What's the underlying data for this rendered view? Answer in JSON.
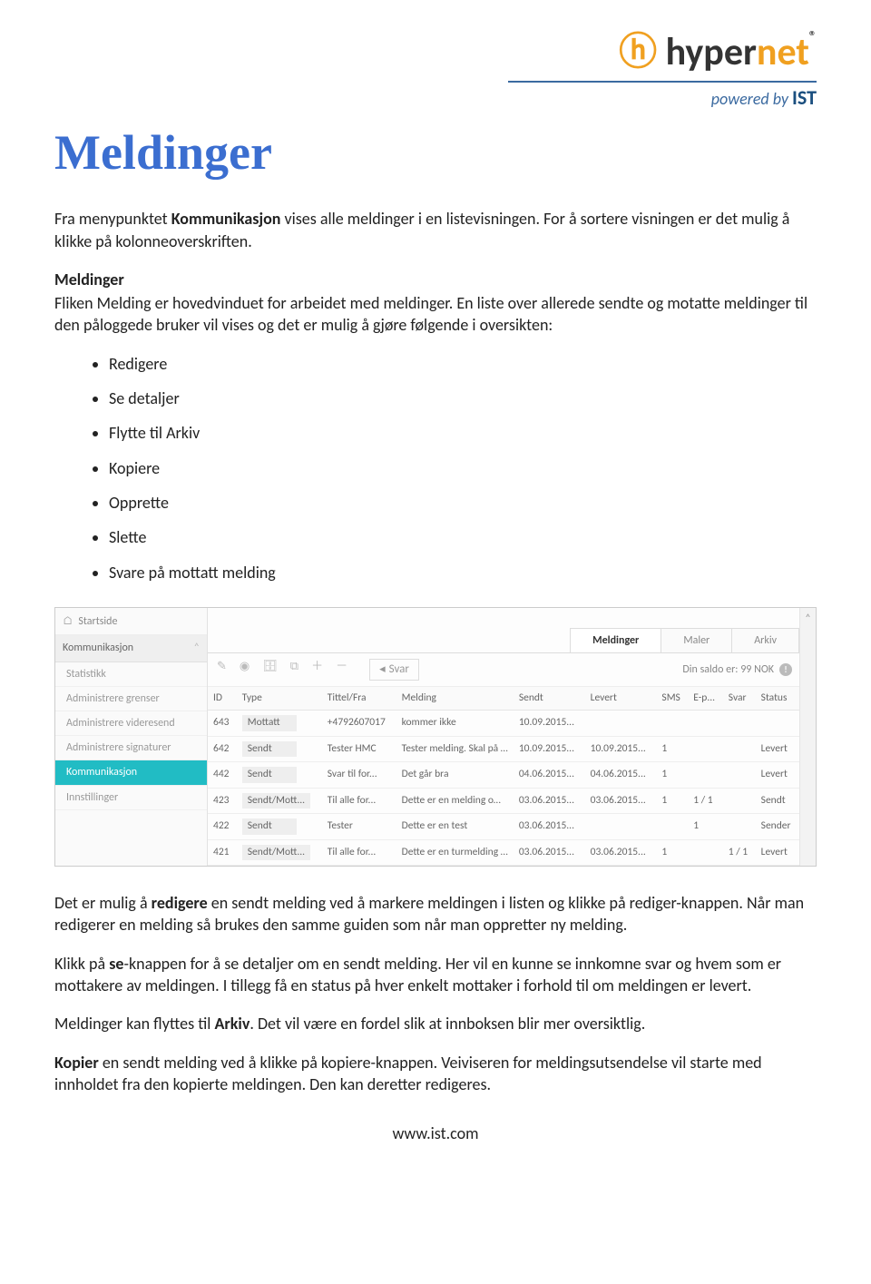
{
  "logo": {
    "brand_part1": "hyper",
    "brand_part2": "net",
    "tagline_prefix": "powered by ",
    "tagline_brand": "IST"
  },
  "title": "Meldinger",
  "intro": {
    "pre": "Fra menypunktet ",
    "bold": "Kommunikasjon",
    "post": " vises alle meldinger i en listevisningen. For å sortere visningen er det mulig å klikke på kolonneoverskriften."
  },
  "section_heading": "Meldinger",
  "section_body": "Fliken Melding er hovedvinduet for arbeidet med meldinger. En liste over allerede sendte og motatte meldinger til den påloggede bruker vil vises og det er mulig å gjøre følgende i oversikten:",
  "actions": [
    "Redigere",
    "Se detaljer",
    "Flytte til Arkiv",
    "Kopiere",
    "Opprette",
    "Slette",
    "Svare på mottatt melding"
  ],
  "app": {
    "sidebar": {
      "home": "Startside",
      "section": "Kommunikasjon",
      "items": [
        "Statistikk",
        "Administrere grenser",
        "Administrere videresend",
        "Administrere signaturer",
        "Kommunikasjon",
        "Innstillinger"
      ],
      "active_index": 4
    },
    "tabs": [
      "Meldinger",
      "Maler",
      "Arkiv"
    ],
    "active_tab_index": 0,
    "toolbar": {
      "svar": "Svar",
      "saldo": "Din saldo er: 99 NOK"
    },
    "columns": [
      "ID",
      "Type",
      "Tittel/Fra",
      "Melding",
      "Sendt",
      "Levert",
      "SMS",
      "E-p...",
      "Svar",
      "Status"
    ],
    "rows": [
      {
        "id": "643",
        "type": "Mottatt",
        "tittel": "+4792607017",
        "melding": "kommer ikke",
        "sendt": "10.09.2015...",
        "levert": "",
        "sms": "",
        "ep": "",
        "svar": "",
        "status": ""
      },
      {
        "id": "642",
        "type": "Sendt",
        "tittel": "Tester HMC",
        "melding": "Tester melding. Skal på tur",
        "sendt": "10.09.2015...",
        "levert": "10.09.2015...",
        "sms": "1",
        "ep": "",
        "svar": "",
        "status": "Levert"
      },
      {
        "id": "442",
        "type": "Sendt",
        "tittel": "Svar til for...",
        "melding": "Det går bra",
        "sendt": "04.06.2015...",
        "levert": "04.06.2015...",
        "sms": "1",
        "ep": "",
        "svar": "",
        "status": "Levert"
      },
      {
        "id": "423",
        "type": "Sendt/Mott...",
        "tittel": "Til alle for...",
        "melding": "Dette er en melding om tu...",
        "sendt": "03.06.2015...",
        "levert": "03.06.2015...",
        "sms": "1",
        "ep": "1 / 1",
        "svar": "",
        "status": "Sendt"
      },
      {
        "id": "422",
        "type": "Sendt",
        "tittel": "Tester",
        "melding": "Dette er en test",
        "sendt": "03.06.2015...",
        "levert": "",
        "sms": "",
        "ep": "1",
        "svar": "",
        "status": "Sender"
      },
      {
        "id": "421",
        "type": "Sendt/Mott...",
        "tittel": "Til alle for...",
        "melding": "Dette er en turmelding en...",
        "sendt": "03.06.2015...",
        "levert": "03.06.2015...",
        "sms": "1",
        "ep": "",
        "svar": "1 / 1",
        "status": "Levert"
      }
    ]
  },
  "para_redigere": {
    "p1": "Det er mulig å ",
    "b1": "redigere",
    "p2": " en sendt melding ved å markere meldingen i listen og klikke på rediger-knappen. Når man redigerer en melding så brukes den samme guiden som når man oppretter ny melding."
  },
  "para_se": {
    "p1": "Klikk på ",
    "b1": "se",
    "p2": "-knappen for å se detaljer om en sendt melding. Her vil en kunne se innkomne svar og hvem som er mottakere av meldingen. I tillegg få en status på hver enkelt mottaker i forhold til om meldingen er levert."
  },
  "para_arkiv": {
    "p1": "Meldinger kan flyttes til ",
    "b1": "Arkiv",
    "p2": ". Det vil være en fordel slik at innboksen blir mer oversiktlig."
  },
  "para_kopier": {
    "b1": "Kopier",
    "p2": " en sendt melding ved å klikke på kopiere-knappen. Veiviseren for meldingsutsendelse vil starte med innholdet fra den kopierte meldingen. Den kan deretter redigeres."
  },
  "footer_url": "www.ist.com"
}
